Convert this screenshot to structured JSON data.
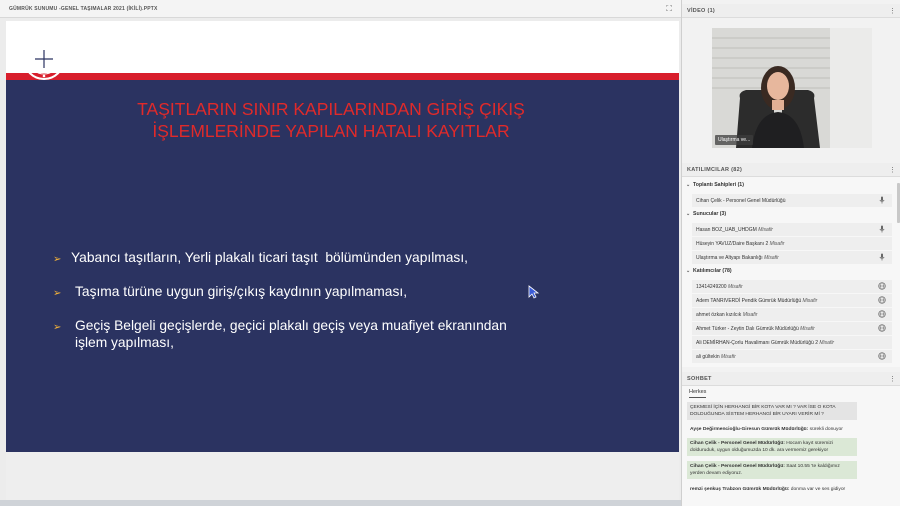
{
  "presentation": {
    "file_title": "GÜMRÜK SUNUMU -GENEL TAŞIMALAR 2021 (İKİLİ).PPTX",
    "ministry_line1": "T.C. ULAŞTIRMA VE",
    "ministry_line2": "ALTYAPI BAKANLIĞI",
    "heading_line1": "TAŞITLARIN SINIR KAPILARINDAN GİRİŞ ÇIKIŞ",
    "heading_line2": "İŞLEMLERİNDE YAPILAN HATALI KAYITLAR",
    "bullets": [
      {
        "arrow": "➢",
        "text": "Yabancı taşıtların, Yerli plakalı ticari taşıt  bölümünden yapılması,"
      },
      {
        "arrow": "➢",
        "text": "Taşıma türüne uygun giriş/çıkış kaydının yapılmaması,"
      },
      {
        "arrow": "➢",
        "text": "Geçiş Belgeli geçişlerde, geçici plakalı geçiş veya muafiyet ekranından\nişlem yapılması,"
      }
    ],
    "colors": {
      "heading": "#e02a2a",
      "slide_bg": "#2b3361",
      "red_bar": "#d81e2c",
      "bullet_arrow": "#f2b23a"
    }
  },
  "video": {
    "title": "VİDEO (1)",
    "caption": "Ulaştırma ve..."
  },
  "participants": {
    "title": "KATILIMCILAR (82)",
    "groups": [
      {
        "label": "Toplantı Sahipleri (1)"
      },
      {
        "label": "Sunucular (3)"
      },
      {
        "label": "Katılımcılar (78)"
      }
    ],
    "rows": [
      {
        "name": "Cihan Çelik - Personel Genel Müdürlüğü",
        "role": "",
        "icon": "mic-icon"
      },
      {
        "name": "Hasan BOZ_UAB_UHDGM",
        "role": "Misafir",
        "icon": "mic-icon"
      },
      {
        "name": "Hüseyin YAVUZ/Daire Başkanı 2",
        "role": "Misafir",
        "icon": ""
      },
      {
        "name": "Ulaştırma ve Altyapı Bakanlığı",
        "role": "Misafir",
        "icon": "mic-icon"
      },
      {
        "name": "13414249200",
        "role": "Misafir",
        "icon": "globe-icon"
      },
      {
        "name": "Adem TANRIVERDİ Pendik Gümrük Müdürlüğü",
        "role": "Misafir",
        "icon": "globe-icon"
      },
      {
        "name": "ahmet özkan kızılcık",
        "role": "Misafir",
        "icon": "globe-icon"
      },
      {
        "name": "Ahmet Türker - Zeytin Dalı Gümrük Müdürlüğü",
        "role": "Misafir",
        "icon": "globe-icon"
      },
      {
        "name": "Ali DEMİRHAN-Çorlu Havalimanı Gümrük Müdürlüğü 2",
        "role": "Misafir",
        "icon": ""
      },
      {
        "name": "ali gültekin",
        "role": "Misafir",
        "icon": "globe-icon"
      }
    ]
  },
  "chat": {
    "title": "SOHBET",
    "tab": "Herkes",
    "messages": [
      {
        "who": "",
        "text": "ÇEKMESİ İÇİN HERHANGİ BİR KOTA VAR MI ? VAR İSE O KOTA DOLDUĞUNDA SİSTEM HERHANGİ BİR UYARI VERİR Mİ ?",
        "style": "grey"
      },
      {
        "who": "Ayşe Değirmencioğlu-Giresun Gümrük Müdürlüğü:",
        "text": " sürekli donuyor",
        "style": "none"
      },
      {
        "who": "Cihan Çelik - Personel Genel Müdürlüğü:",
        "text": " Hocam kayıt süremizi dolduruduk, uygun olduğumuzda 10 dk. ara vermemiz gerekiyor",
        "style": "green"
      },
      {
        "who": "Cihan Çelik - Personel Genel Müdürlüğü:",
        "text": " Saat 10.55 'te kaldığımız yerden devam ediyoruz.",
        "style": "green"
      },
      {
        "who": "remzi şenkuş Trabzon Gümrük Müdürlüğü:",
        "text": " donma var ve ses gidiyor",
        "style": "none"
      }
    ]
  }
}
